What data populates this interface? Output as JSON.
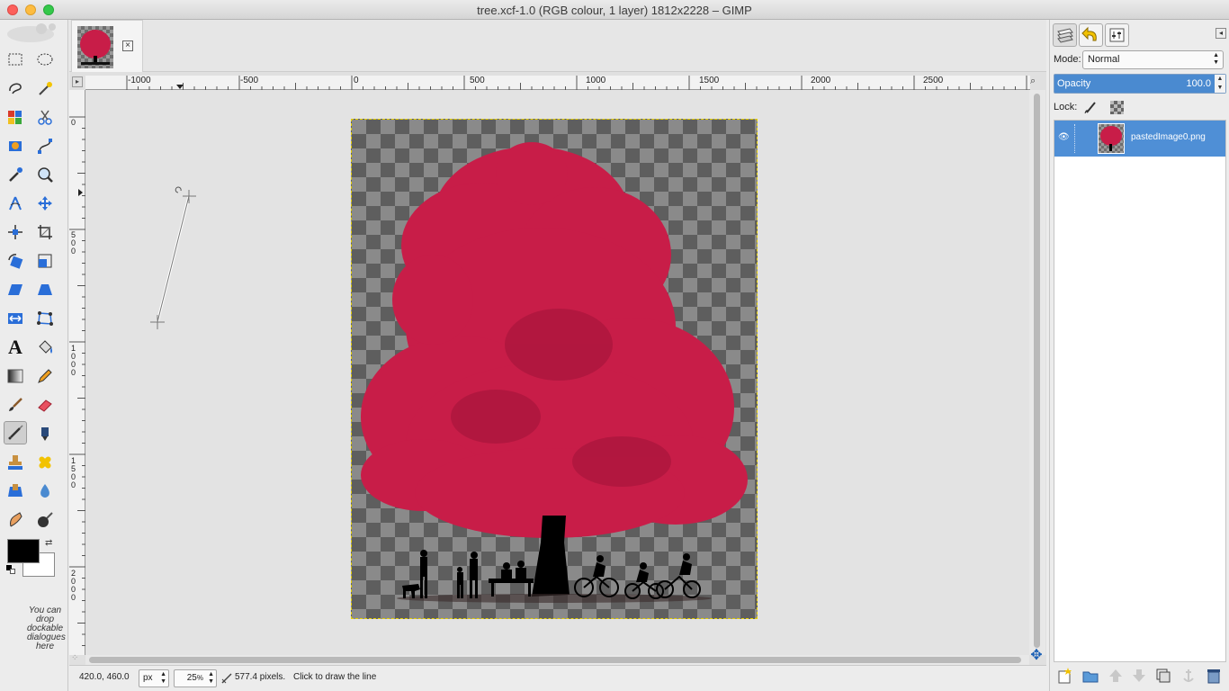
{
  "window": {
    "title": "tree.xcf-1.0 (RGB colour, 1 layer) 1812x2228 – GIMP"
  },
  "toolbox": {
    "tools": [
      "rect-select",
      "ellipse-select",
      "free-select",
      "fuzzy-select",
      "select-by-color",
      "scissors",
      "foreground-select",
      "paths",
      "color-picker",
      "zoom",
      "measure",
      "move",
      "align",
      "crop",
      "rotate",
      "scale",
      "shear",
      "perspective",
      "flip",
      "cage",
      "text",
      "bucket-fill",
      "blend",
      "pencil",
      "paintbrush",
      "eraser",
      "airbrush",
      "ink",
      "clone",
      "heal",
      "perspective-clone",
      "blur",
      "smudge",
      "dodge-burn"
    ],
    "active_tool": "airbrush",
    "foreground_color": "#000000",
    "background_color": "#ffffff",
    "dock_hint": "You can drop dockable dialogues here"
  },
  "rulers": {
    "horizontal_labels": [
      "-1000",
      "-500",
      "0",
      "500",
      "1000",
      "1500",
      "2000",
      "2500"
    ],
    "vertical_labels": [
      "0",
      "5 0 0",
      "1 0 0 0",
      "1 5 0 0",
      "2 0 0 0"
    ]
  },
  "measure_line": {
    "length_label": "577.4 pixels"
  },
  "status": {
    "coords": "420.0, 460.0",
    "unit": "px",
    "zoom": "25",
    "zoom_suffix": "%",
    "message_value": "577.4 pixels.",
    "message_hint": "Click to draw the line"
  },
  "colors": {
    "tree_red": "#c81d48",
    "layer_select": "#4f8fd6",
    "marching_ants": "#e6d000"
  },
  "layers_dock": {
    "mode_label": "Mode:",
    "mode_value": "Normal",
    "opacity_label": "Opacity",
    "opacity_value": "100.0",
    "lock_label": "Lock:",
    "layers": [
      {
        "name": "pastedImage0.png",
        "visible": true
      }
    ],
    "bottom_buttons": [
      "new-layer",
      "new-layer-group",
      "raise-layer",
      "lower-layer",
      "duplicate-layer",
      "anchor-layer",
      "delete-layer"
    ]
  }
}
